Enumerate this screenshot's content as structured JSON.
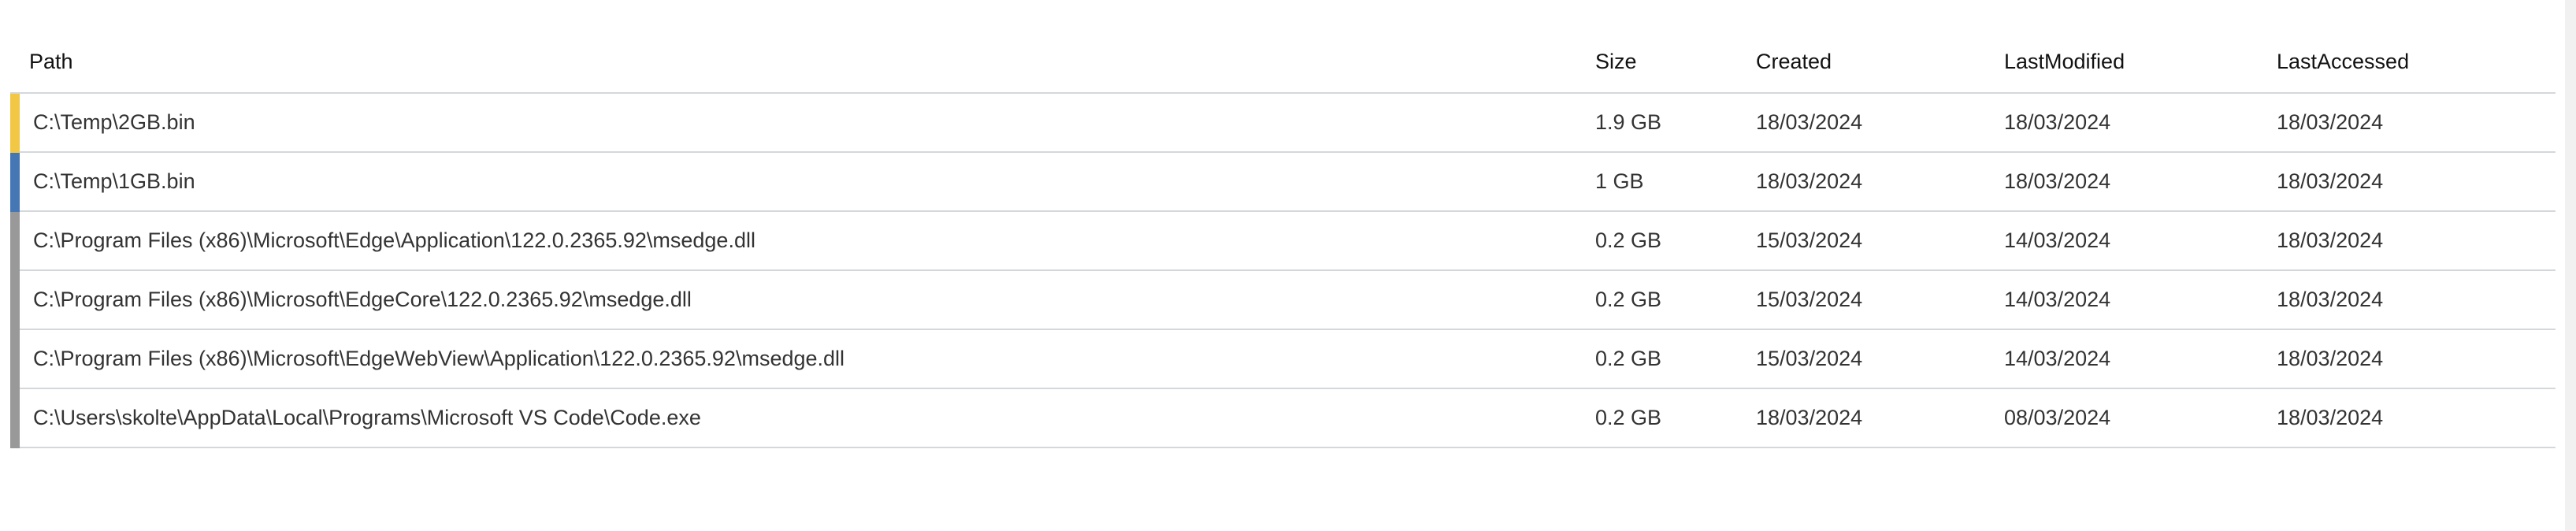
{
  "columns": [
    "Path",
    "Size",
    "Created",
    "LastModified",
    "LastAccessed"
  ],
  "rows": [
    {
      "path": "C:\\Temp\\2GB.bin",
      "size": "1.9 GB",
      "created": "18/03/2024",
      "modified": "18/03/2024",
      "accessed": "18/03/2024",
      "color": "#f2c744"
    },
    {
      "path": "C:\\Temp\\1GB.bin",
      "size": "1 GB",
      "created": "18/03/2024",
      "modified": "18/03/2024",
      "accessed": "18/03/2024",
      "color": "#4577b4"
    },
    {
      "path": "C:\\Program Files (x86)\\Microsoft\\Edge\\Application\\122.0.2365.92\\msedge.dll",
      "size": "0.2 GB",
      "created": "15/03/2024",
      "modified": "14/03/2024",
      "accessed": "18/03/2024",
      "color": "#999999"
    },
    {
      "path": "C:\\Program Files (x86)\\Microsoft\\EdgeCore\\122.0.2365.92\\msedge.dll",
      "size": "0.2 GB",
      "created": "15/03/2024",
      "modified": "14/03/2024",
      "accessed": "18/03/2024",
      "color": "#999999"
    },
    {
      "path": "C:\\Program Files (x86)\\Microsoft\\EdgeWebView\\Application\\122.0.2365.92\\msedge.dll",
      "size": "0.2 GB",
      "created": "15/03/2024",
      "modified": "14/03/2024",
      "accessed": "18/03/2024",
      "color": "#999999"
    },
    {
      "path": "C:\\Users\\skolte\\AppData\\Local\\Programs\\Microsoft VS Code\\Code.exe",
      "size": "0.2 GB",
      "created": "18/03/2024",
      "modified": "08/03/2024",
      "accessed": "18/03/2024",
      "color": "#999999"
    }
  ]
}
